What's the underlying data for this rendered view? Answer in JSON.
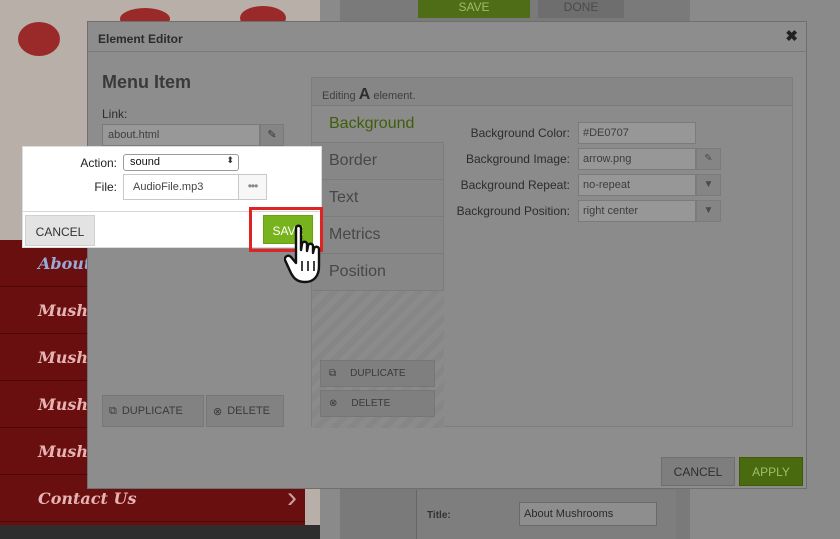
{
  "background": {
    "top_save_label": "SAVE",
    "top_done_label": "DONE",
    "nav_items": [
      "About",
      "Mushrooms",
      "Mushrooms",
      "Mushrooms",
      "Mushrooms",
      "Contact Us"
    ],
    "form_title_label": "Title:",
    "form_title_value": "About Mushrooms"
  },
  "modal": {
    "title": "Element Editor",
    "close_glyph": "✖",
    "heading": "Menu Item",
    "link_label": "Link:",
    "link_value": "about.html",
    "duplicate_label": "DUPLICATE",
    "delete_label": "DELETE",
    "cancel_label": "CANCEL",
    "apply_label": "APPLY"
  },
  "panel": {
    "editing_prefix": "Editing",
    "editing_element": "A",
    "editing_suffix": "element.",
    "tabs": [
      "Background",
      "Border",
      "Text",
      "Metrics",
      "Position"
    ],
    "active_tab": "Background",
    "duplicate_label": "DUPLICATE",
    "delete_label": "DELETE",
    "props": {
      "color_label": "Background Color:",
      "color_value": "#DE0707",
      "image_label": "Background Image:",
      "image_value": "arrow.png",
      "repeat_label": "Background Repeat:",
      "repeat_value": "no-repeat",
      "position_label": "Background Position:",
      "position_value": "right center"
    }
  },
  "popup": {
    "action_label": "Action:",
    "action_value": "sound",
    "file_label": "File:",
    "file_value": "AudioFile.mp3",
    "file_more": "•••",
    "cancel_label": "CANCEL",
    "save_label": "SAVE"
  },
  "colors": {
    "save_green": "#77b31c",
    "highlight_red": "#e12222",
    "apply_green": "#4a6a0f"
  }
}
